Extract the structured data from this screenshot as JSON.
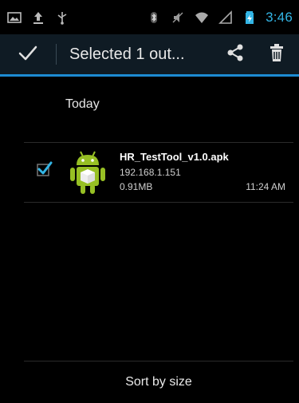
{
  "status_bar": {
    "time": "3:46",
    "icons": [
      "picture-icon",
      "upload-icon",
      "usb-icon",
      "bluetooth-icon",
      "mute-icon",
      "wifi-icon",
      "signal-icon",
      "battery-icon"
    ]
  },
  "action_bar": {
    "title": "Selected 1 out...",
    "done_icon": "checkmark-icon",
    "share_icon": "share-icon",
    "delete_icon": "trash-icon"
  },
  "list": {
    "section_header": "Today",
    "items": [
      {
        "name": "HR_TestTool_v1.0.apk",
        "host": "192.168.1.151",
        "size": "0.91MB",
        "time": "11:24 AM",
        "checked": true,
        "icon": "android-apk-icon"
      }
    ]
  },
  "bottom": {
    "sort_label": "Sort by size"
  },
  "colors": {
    "accent": "#33b5e5",
    "action_bar_bg": "#0f1b24",
    "action_bar_underline": "#1d8bd3",
    "android_green": "#97c024"
  }
}
